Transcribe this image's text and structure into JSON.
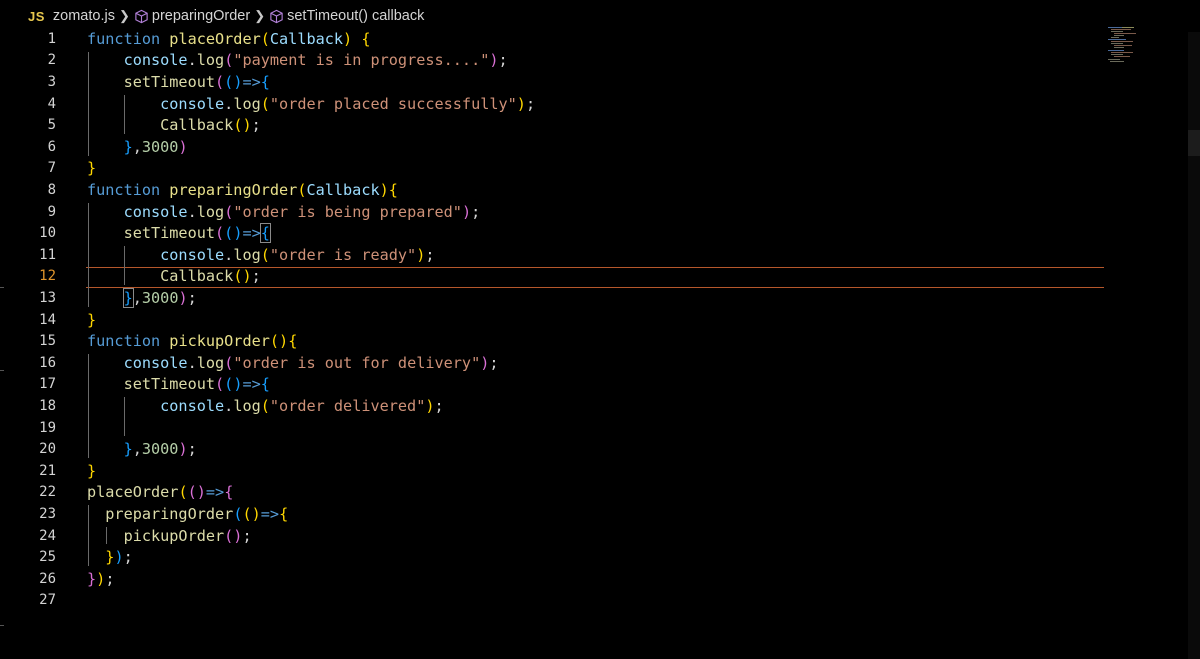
{
  "breadcrumb": {
    "file_icon": "JS",
    "file_name": "zomato.js",
    "crumb1": "preparingOrder",
    "crumb2": "setTimeout() callback",
    "crumb_icon": "method-cube-icon"
  },
  "editor": {
    "active_line": 12,
    "lines": [
      {
        "n": "1"
      },
      {
        "n": "2"
      },
      {
        "n": "3"
      },
      {
        "n": "4"
      },
      {
        "n": "5"
      },
      {
        "n": "6"
      },
      {
        "n": "7"
      },
      {
        "n": "8"
      },
      {
        "n": "9"
      },
      {
        "n": "10"
      },
      {
        "n": "11"
      },
      {
        "n": "12"
      },
      {
        "n": "13"
      },
      {
        "n": "14"
      },
      {
        "n": "15"
      },
      {
        "n": "16"
      },
      {
        "n": "17"
      },
      {
        "n": "18"
      },
      {
        "n": "19"
      },
      {
        "n": "20"
      },
      {
        "n": "21"
      },
      {
        "n": "22"
      },
      {
        "n": "23"
      },
      {
        "n": "24"
      },
      {
        "n": "25"
      },
      {
        "n": "26"
      },
      {
        "n": "27"
      }
    ],
    "code": [
      [
        {
          "t": "function ",
          "c": "t-kw"
        },
        {
          "t": "placeOrder",
          "c": "t-fn"
        },
        {
          "t": "(",
          "c": "t-p1"
        },
        {
          "t": "Callback",
          "c": "t-var"
        },
        {
          "t": ") ",
          "c": "t-p1"
        },
        {
          "t": "{",
          "c": "t-p1"
        }
      ],
      [
        {
          "t": "    console",
          "c": "t-var"
        },
        {
          "t": ".",
          "c": "t-pl"
        },
        {
          "t": "log",
          "c": "t-fn2"
        },
        {
          "t": "(",
          "c": "t-p2"
        },
        {
          "t": "\"payment is in progress....\"",
          "c": "t-str"
        },
        {
          "t": ")",
          "c": "t-p2"
        },
        {
          "t": ";",
          "c": "t-pl"
        }
      ],
      [
        {
          "t": "    setTimeout",
          "c": "t-fn2"
        },
        {
          "t": "(",
          "c": "t-p2"
        },
        {
          "t": "()",
          "c": "t-p3"
        },
        {
          "t": "=>",
          "c": "t-kw"
        },
        {
          "t": "{",
          "c": "t-p3"
        }
      ],
      [
        {
          "t": "        console",
          "c": "t-var"
        },
        {
          "t": ".",
          "c": "t-pl"
        },
        {
          "t": "log",
          "c": "t-fn2"
        },
        {
          "t": "(",
          "c": "t-p1"
        },
        {
          "t": "\"order placed successfully\"",
          "c": "t-str"
        },
        {
          "t": ")",
          "c": "t-p1"
        },
        {
          "t": ";",
          "c": "t-pl"
        }
      ],
      [
        {
          "t": "        Callback",
          "c": "t-fn2"
        },
        {
          "t": "()",
          "c": "t-p1"
        },
        {
          "t": ";",
          "c": "t-pl"
        }
      ],
      [
        {
          "t": "    }",
          "c": "t-p3"
        },
        {
          "t": ",",
          "c": "t-pl"
        },
        {
          "t": "3000",
          "c": "t-num"
        },
        {
          "t": ")",
          "c": "t-p2"
        }
      ],
      [
        {
          "t": "}",
          "c": "t-p1"
        }
      ],
      [
        {
          "t": "function ",
          "c": "t-kw"
        },
        {
          "t": "preparingOrder",
          "c": "t-fn"
        },
        {
          "t": "(",
          "c": "t-p1"
        },
        {
          "t": "Callback",
          "c": "t-var"
        },
        {
          "t": ")",
          "c": "t-p1"
        },
        {
          "t": "{",
          "c": "t-p1"
        }
      ],
      [
        {
          "t": "    console",
          "c": "t-var"
        },
        {
          "t": ".",
          "c": "t-pl"
        },
        {
          "t": "log",
          "c": "t-fn2"
        },
        {
          "t": "(",
          "c": "t-p2"
        },
        {
          "t": "\"order is being prepared\"",
          "c": "t-str"
        },
        {
          "t": ")",
          "c": "t-p2"
        },
        {
          "t": ";",
          "c": "t-pl"
        }
      ],
      [
        {
          "t": "    setTimeout",
          "c": "t-fn2"
        },
        {
          "t": "(",
          "c": "t-p2"
        },
        {
          "t": "()",
          "c": "t-p3"
        },
        {
          "t": "=>",
          "c": "t-kw"
        },
        {
          "t": "{",
          "c": "t-p3 bracket-box"
        }
      ],
      [
        {
          "t": "        console",
          "c": "t-var"
        },
        {
          "t": ".",
          "c": "t-pl"
        },
        {
          "t": "log",
          "c": "t-fn2"
        },
        {
          "t": "(",
          "c": "t-p1"
        },
        {
          "t": "\"order is ready\"",
          "c": "t-str"
        },
        {
          "t": ")",
          "c": "t-p1"
        },
        {
          "t": ";",
          "c": "t-pl"
        }
      ],
      [
        {
          "t": "        Callback",
          "c": "t-fn2"
        },
        {
          "t": "()",
          "c": "t-p1"
        },
        {
          "t": ";",
          "c": "t-pl"
        }
      ],
      [
        {
          "t": "    ",
          "c": "t-pl"
        },
        {
          "t": "}",
          "c": "t-p3 bracket-box"
        },
        {
          "t": ",",
          "c": "t-pl"
        },
        {
          "t": "3000",
          "c": "t-num"
        },
        {
          "t": ")",
          "c": "t-p2"
        },
        {
          "t": ";",
          "c": "t-pl"
        }
      ],
      [
        {
          "t": "}",
          "c": "t-p1"
        }
      ],
      [
        {
          "t": "function ",
          "c": "t-kw"
        },
        {
          "t": "pickupOrder",
          "c": "t-fn"
        },
        {
          "t": "()",
          "c": "t-p1"
        },
        {
          "t": "{",
          "c": "t-p1"
        }
      ],
      [
        {
          "t": "    console",
          "c": "t-var"
        },
        {
          "t": ".",
          "c": "t-pl"
        },
        {
          "t": "log",
          "c": "t-fn2"
        },
        {
          "t": "(",
          "c": "t-p2"
        },
        {
          "t": "\"order is out for delivery\"",
          "c": "t-str"
        },
        {
          "t": ")",
          "c": "t-p2"
        },
        {
          "t": ";",
          "c": "t-pl"
        }
      ],
      [
        {
          "t": "    setTimeout",
          "c": "t-fn2"
        },
        {
          "t": "(",
          "c": "t-p2"
        },
        {
          "t": "()",
          "c": "t-p3"
        },
        {
          "t": "=>",
          "c": "t-kw"
        },
        {
          "t": "{",
          "c": "t-p3"
        }
      ],
      [
        {
          "t": "        console",
          "c": "t-var"
        },
        {
          "t": ".",
          "c": "t-pl"
        },
        {
          "t": "log",
          "c": "t-fn2"
        },
        {
          "t": "(",
          "c": "t-p1"
        },
        {
          "t": "\"order delivered\"",
          "c": "t-str"
        },
        {
          "t": ")",
          "c": "t-p1"
        },
        {
          "t": ";",
          "c": "t-pl"
        }
      ],
      [],
      [
        {
          "t": "    }",
          "c": "t-p3"
        },
        {
          "t": ",",
          "c": "t-pl"
        },
        {
          "t": "3000",
          "c": "t-num"
        },
        {
          "t": ")",
          "c": "t-p2"
        },
        {
          "t": ";",
          "c": "t-pl"
        }
      ],
      [
        {
          "t": "}",
          "c": "t-p1"
        }
      ],
      [
        {
          "t": "placeOrder",
          "c": "t-fn2"
        },
        {
          "t": "(",
          "c": "t-p1"
        },
        {
          "t": "()",
          "c": "t-p2"
        },
        {
          "t": "=>",
          "c": "t-kw"
        },
        {
          "t": "{",
          "c": "t-p2"
        }
      ],
      [
        {
          "t": "  preparingOrder",
          "c": "t-fn2"
        },
        {
          "t": "(",
          "c": "t-p3"
        },
        {
          "t": "()",
          "c": "t-p1"
        },
        {
          "t": "=>",
          "c": "t-kw"
        },
        {
          "t": "{",
          "c": "t-p1"
        }
      ],
      [
        {
          "t": "    pickupOrder",
          "c": "t-fn2"
        },
        {
          "t": "()",
          "c": "t-p2"
        },
        {
          "t": ";",
          "c": "t-pl"
        }
      ],
      [
        {
          "t": "  }",
          "c": "t-p1"
        },
        {
          "t": ")",
          "c": "t-p3"
        },
        {
          "t": ";",
          "c": "t-pl"
        }
      ],
      [
        {
          "t": "}",
          "c": "t-p2"
        },
        {
          "t": ")",
          "c": "t-p1"
        },
        {
          "t": ";",
          "c": "t-pl"
        }
      ],
      []
    ]
  }
}
